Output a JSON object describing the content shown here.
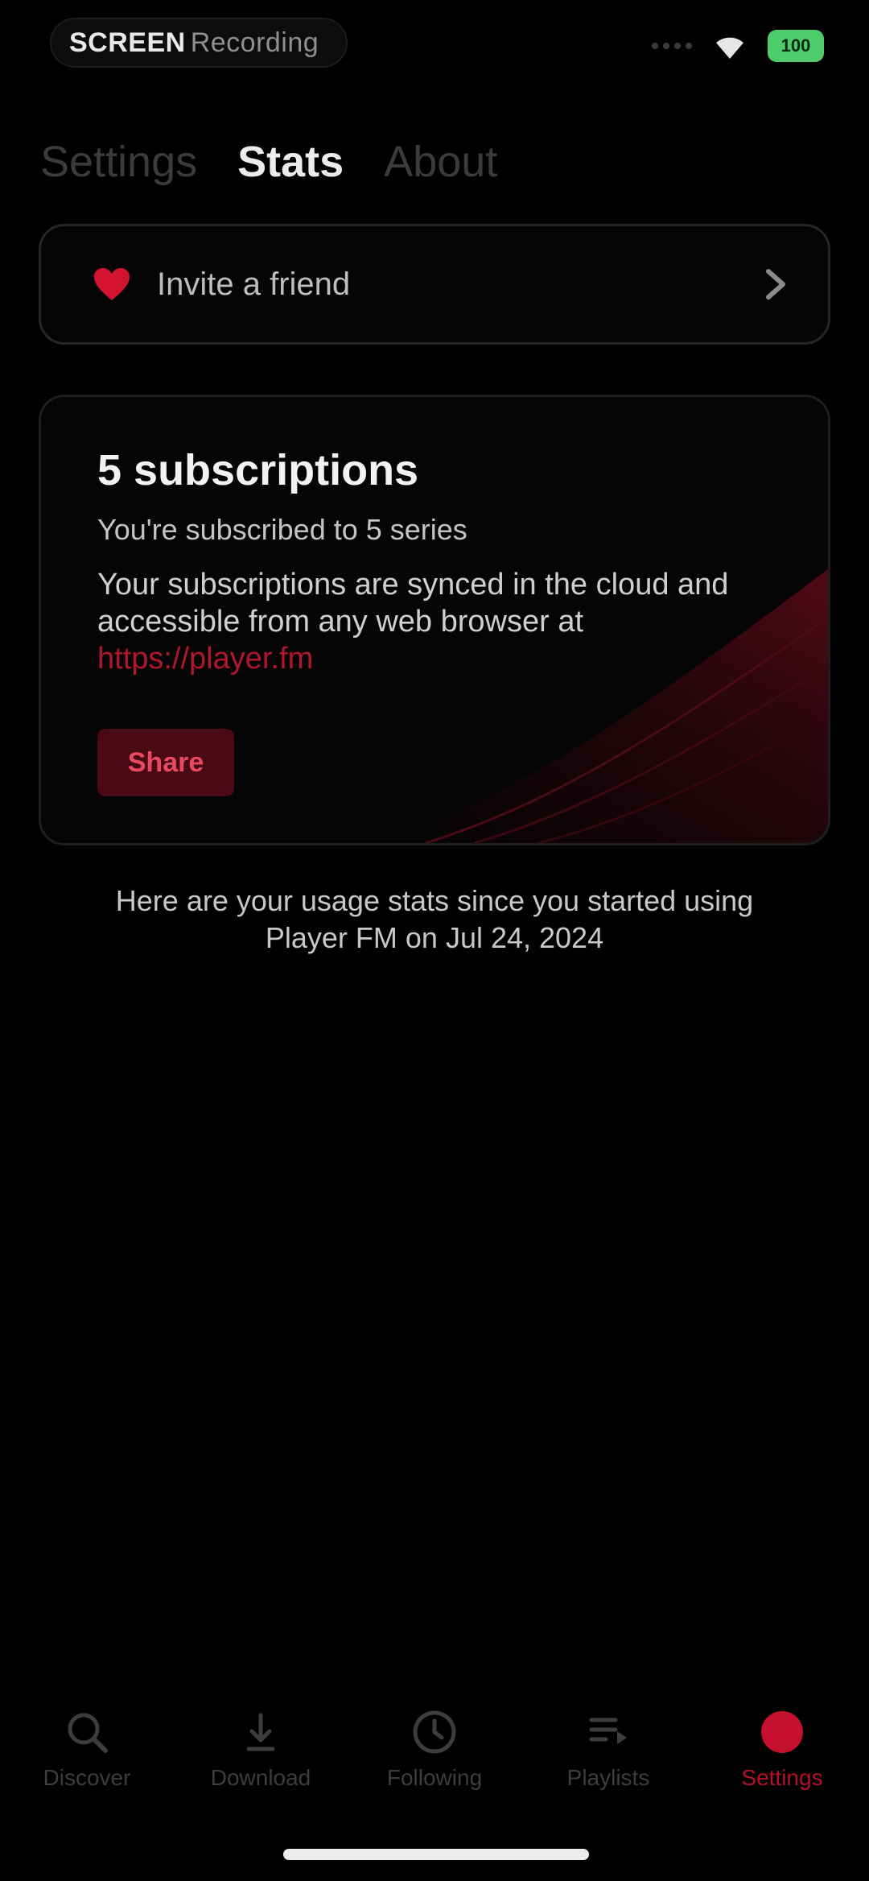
{
  "status_bar": {
    "pill_bold": "SCREEN",
    "pill_light": "Recording",
    "battery": "100"
  },
  "top_tabs": [
    {
      "label": "Settings",
      "active": false
    },
    {
      "label": "Stats",
      "active": true
    },
    {
      "label": "About",
      "active": false
    }
  ],
  "invite": {
    "label": "Invite a friend",
    "icon": "heart-icon"
  },
  "subscriptions": {
    "title": "5 subscriptions",
    "line": "You're subscribed to 5 series",
    "desc_prefix": "Your subscriptions are synced in the cloud and accessible from any web browser at ",
    "link": "https://player.fm",
    "share_label": "Share"
  },
  "usage": {
    "text": "Here are your usage stats since you started using Player FM on Jul 24, 2024"
  },
  "bottom_nav": [
    {
      "label": "Discover",
      "icon": "search-icon",
      "active": false
    },
    {
      "label": "Download",
      "icon": "download-icon",
      "active": false
    },
    {
      "label": "Following",
      "icon": "clock-icon",
      "active": false
    },
    {
      "label": "Playlists",
      "icon": "playlist-icon",
      "active": false
    },
    {
      "label": "Settings",
      "icon": "settings-icon",
      "active": true
    }
  ],
  "colors": {
    "background": "#000000",
    "accent": "#b3102b",
    "card_border": "#262626",
    "battery": "#4ecb6a"
  }
}
